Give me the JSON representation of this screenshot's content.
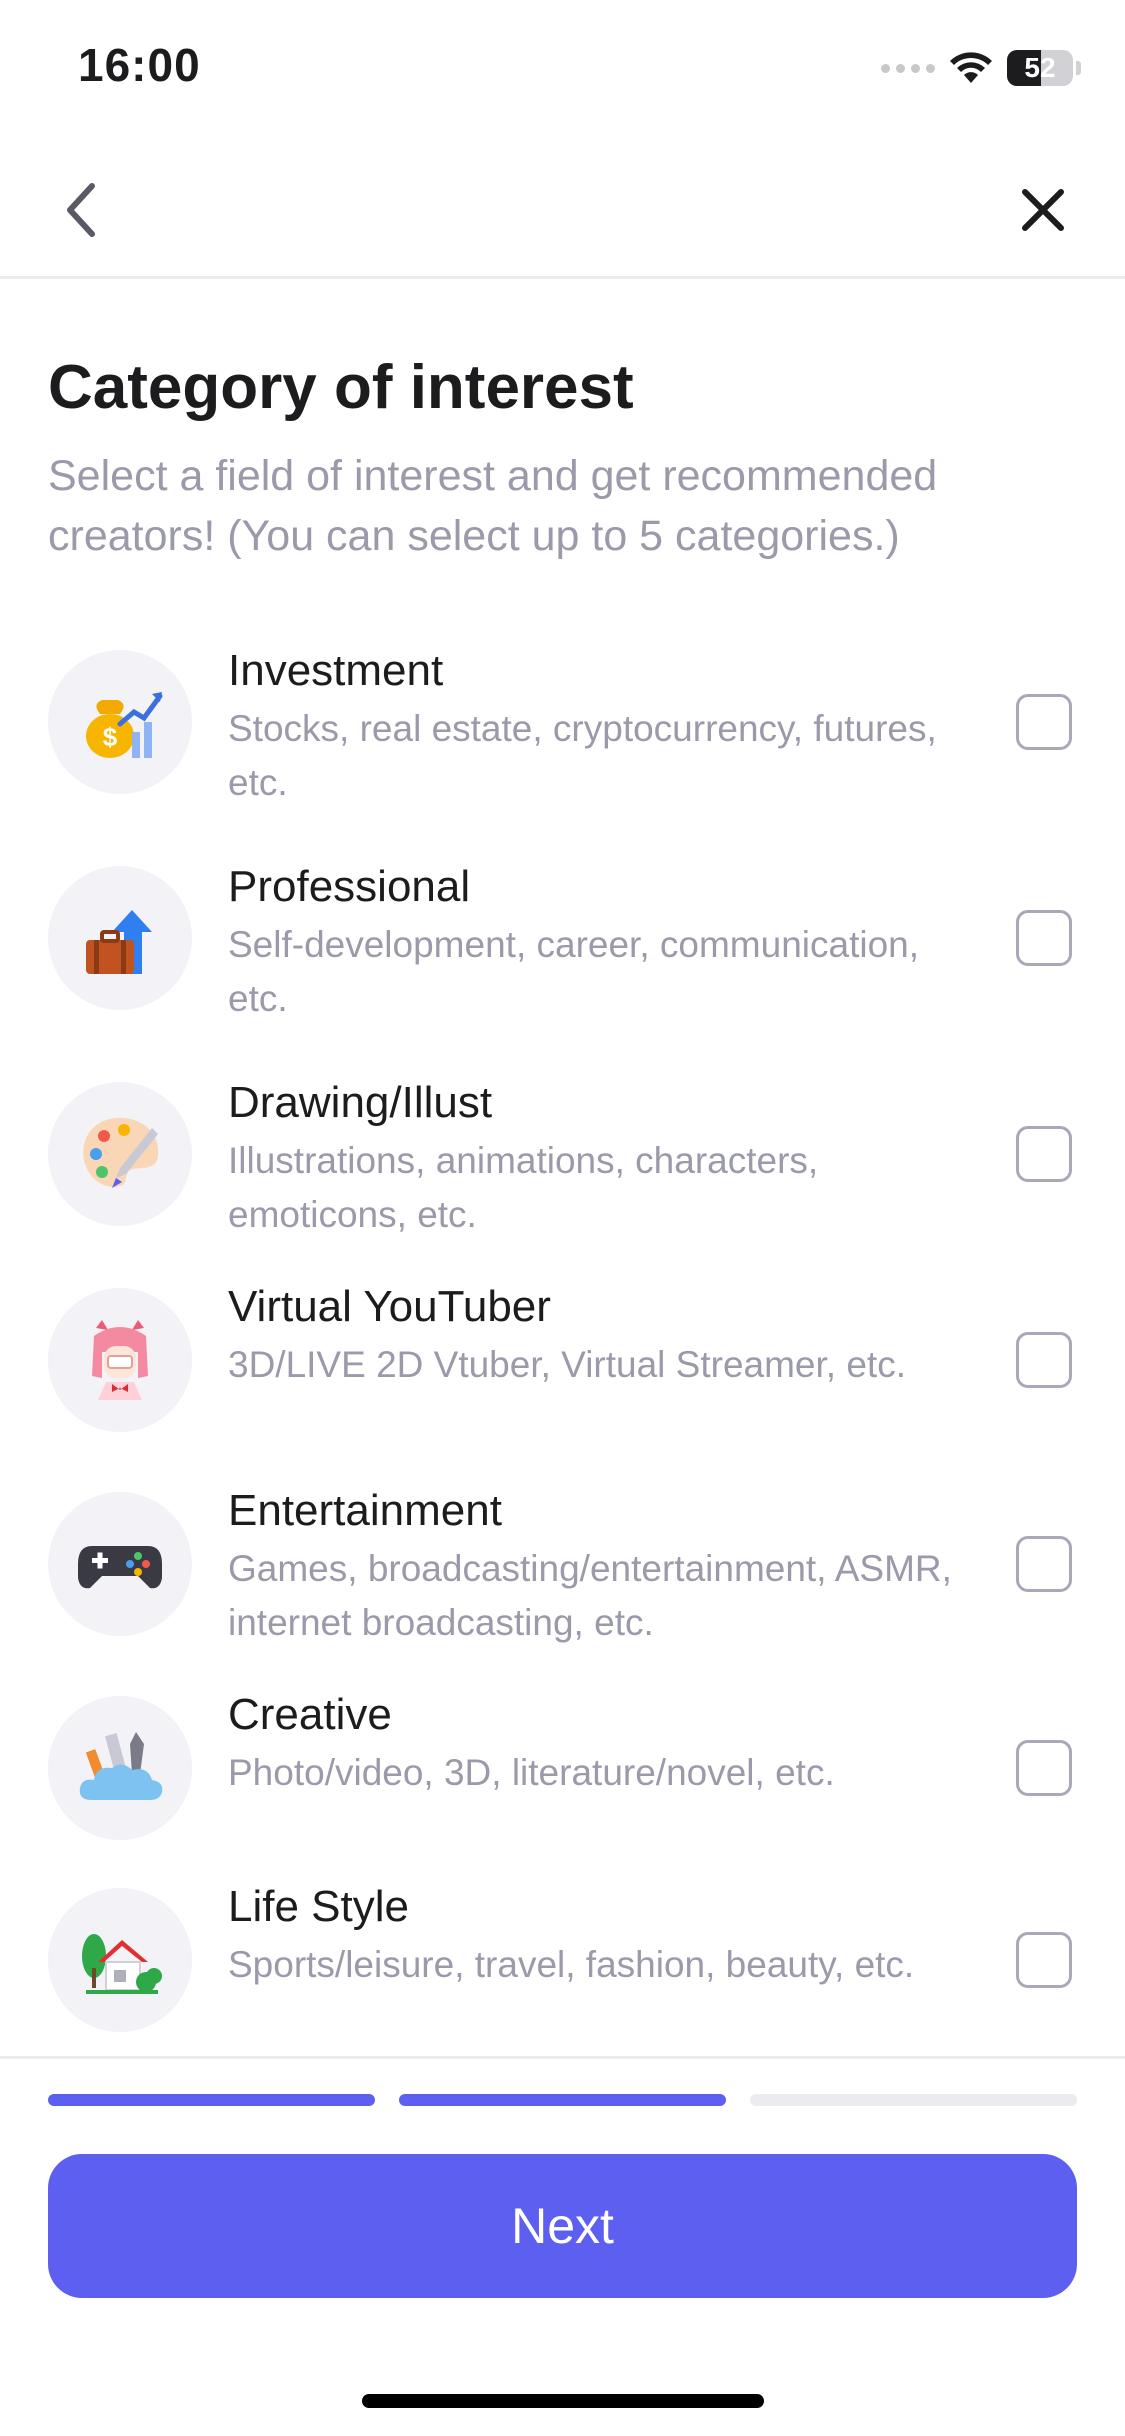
{
  "status_bar": {
    "time": "16:00",
    "battery_level": "52",
    "battery_fraction": 0.52,
    "icons": [
      "signal-dots-icon",
      "wifi-icon",
      "battery-icon"
    ]
  },
  "nav": {
    "back_icon": "chevron-left-icon",
    "close_icon": "close-icon"
  },
  "page": {
    "title": "Category of interest",
    "subtitle": "Select a field of interest and get recommended creators! (You can select up to 5 categories.)"
  },
  "categories": [
    {
      "title": "Investment",
      "desc": "Stocks, real estate, cryptocurrency, futures, etc.",
      "icon": "money-bag-chart-icon",
      "checked": false
    },
    {
      "title": "Professional",
      "desc": "Self-development, career, communication, etc.",
      "icon": "briefcase-arrow-icon",
      "checked": false
    },
    {
      "title": "Drawing/Illust",
      "desc": "Illustrations, animations, characters, emoticons, etc.",
      "icon": "palette-brush-icon",
      "checked": false
    },
    {
      "title": "Virtual YouTuber",
      "desc": "3D/LIVE 2D Vtuber, Virtual Streamer, etc.",
      "icon": "vtuber-girl-icon",
      "checked": false
    },
    {
      "title": "Entertainment",
      "desc": "Games, broadcasting/entertainment, ASMR, internet broadcasting, etc.",
      "icon": "gamepad-icon",
      "checked": false
    },
    {
      "title": "Creative",
      "desc": "Photo/video, 3D, literature/novel, etc.",
      "icon": "cloud-tools-icon",
      "checked": false
    },
    {
      "title": "Life Style",
      "desc": "Sports/leisure, travel, fashion, beauty, etc.",
      "icon": "house-tree-icon",
      "checked": false
    }
  ],
  "progress": {
    "step": 2,
    "total": 3,
    "active_color": "#5d5ff0",
    "inactive_color": "#ececf0"
  },
  "next_button": {
    "label": "Next",
    "color": "#5d5ff0"
  }
}
